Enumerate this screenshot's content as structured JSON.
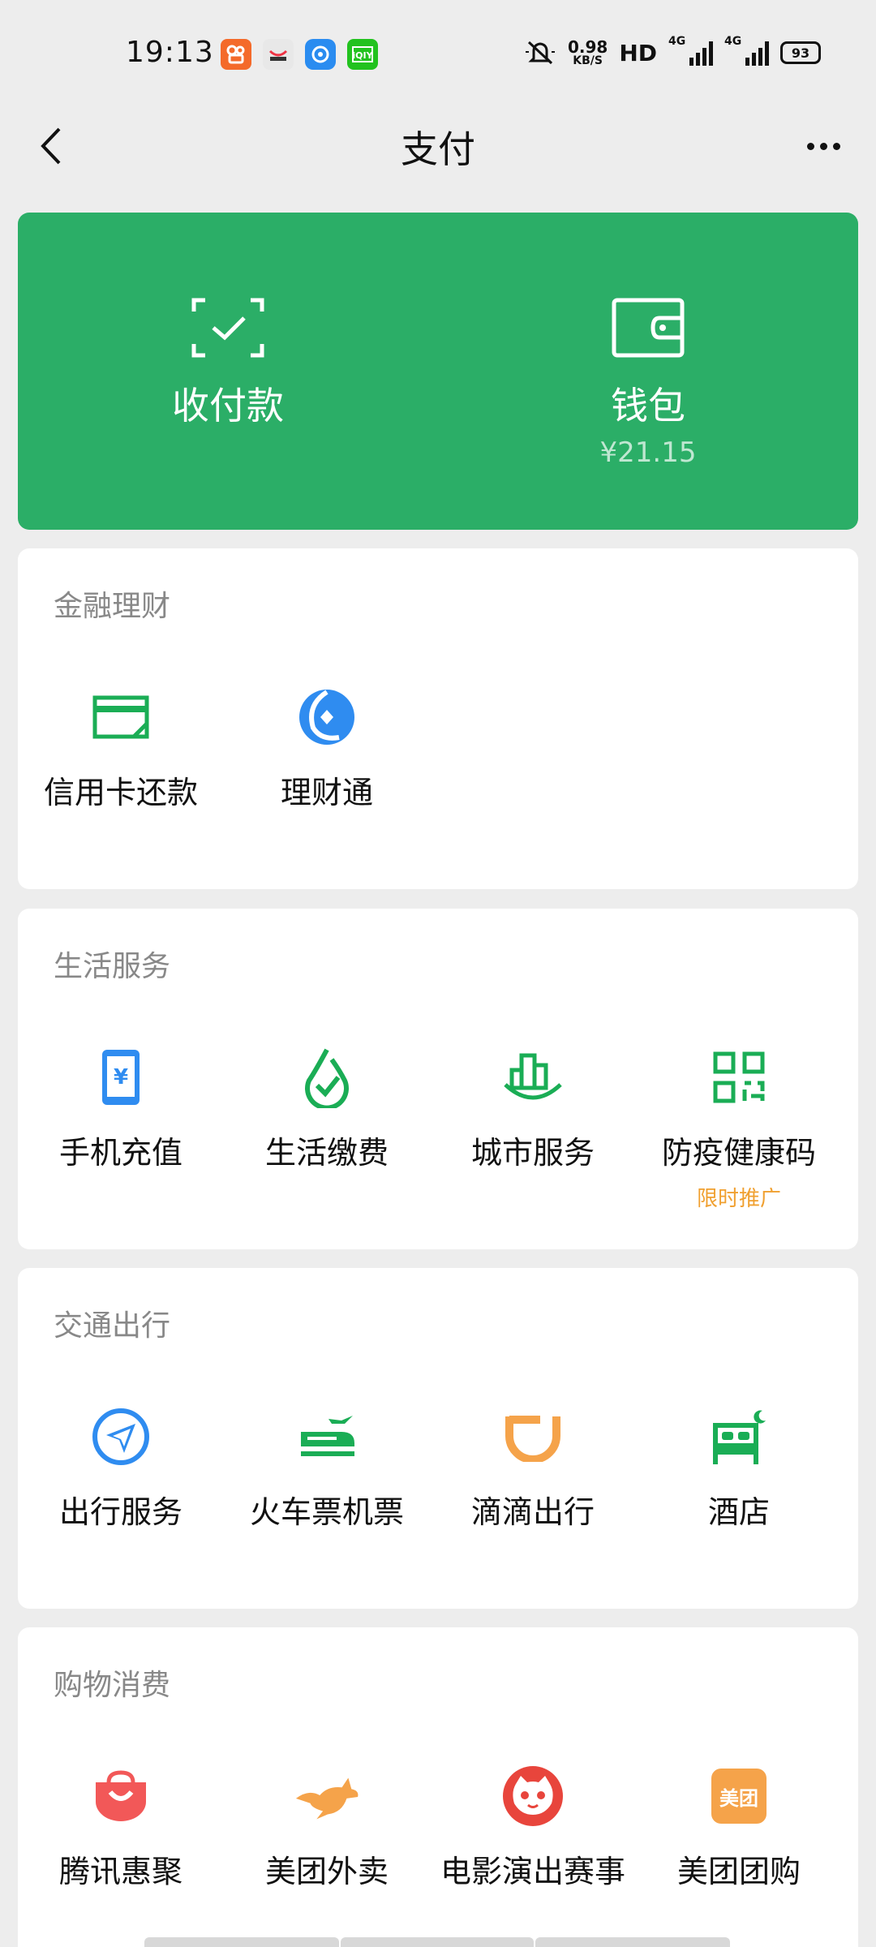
{
  "status_bar": {
    "time": "19:13",
    "speed_value": "0.98",
    "speed_unit": "KB/S",
    "hd": "HD",
    "net1": "4G",
    "net2": "4G",
    "battery": "93"
  },
  "nav": {
    "title": "支付"
  },
  "top_card": {
    "pay_label": "收付款",
    "wallet_label": "钱包",
    "wallet_amount": "¥21.15"
  },
  "sections": {
    "finance": {
      "title": "金融理财",
      "items": [
        {
          "label": "信用卡还款",
          "icon": "credit-card-icon"
        },
        {
          "label": "理财通",
          "icon": "wealth-icon"
        }
      ]
    },
    "life": {
      "title": "生活服务",
      "items": [
        {
          "label": "手机充值",
          "icon": "phone-topup-icon"
        },
        {
          "label": "生活缴费",
          "icon": "utility-icon"
        },
        {
          "label": "城市服务",
          "icon": "city-icon"
        },
        {
          "label": "防疫健康码",
          "icon": "qr-code-icon",
          "promo": "限时推广"
        }
      ]
    },
    "travel": {
      "title": "交通出行",
      "items": [
        {
          "label": "出行服务",
          "icon": "navigation-icon"
        },
        {
          "label": "火车票机票",
          "icon": "train-icon"
        },
        {
          "label": "滴滴出行",
          "icon": "didi-icon"
        },
        {
          "label": "酒店",
          "icon": "hotel-bed-icon"
        }
      ]
    },
    "shopping": {
      "title": "购物消费",
      "items": [
        {
          "label": "腾讯惠聚",
          "icon": "shopping-bag-icon"
        },
        {
          "label": "美团外卖",
          "icon": "kangaroo-icon"
        },
        {
          "label": "电影演出赛事",
          "icon": "cat-icon"
        },
        {
          "label": "美团团购",
          "icon": "meituan-icon",
          "badge": "美团"
        }
      ]
    }
  },
  "colors": {
    "accent_green": "#2bae67",
    "icon_green": "#1aad55",
    "icon_blue": "#2f8cf0",
    "icon_orange": "#f5a34a",
    "icon_red": "#f25858",
    "promo": "#f0a030"
  }
}
